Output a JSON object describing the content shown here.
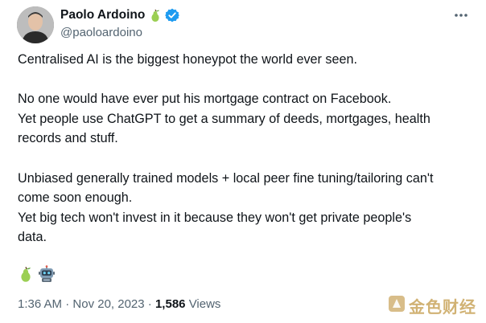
{
  "author": {
    "display_name": "Paolo Ardoino",
    "handle": "@paoloardoino",
    "name_emoji": "pear-icon",
    "verified": true
  },
  "tweet": {
    "paragraphs": [
      [
        "Centralised AI is the biggest honeypot the world ever seen."
      ],
      [
        "No one would have ever put his mortgage contract on Facebook.",
        "Yet people use ChatGPT to get a summary of deeds, mortgages, health",
        "records and stuff."
      ],
      [
        "Unbiased generally trained models + local peer fine tuning/tailoring can't",
        "come soon enough.",
        "Yet big tech won't invest in it because they won't get private people's",
        "data."
      ]
    ],
    "emojis": [
      "pear-icon",
      "robot-icon"
    ]
  },
  "meta": {
    "time": "1:36 AM",
    "separator": "·",
    "date": "Nov 20, 2023",
    "views_count": "1,586",
    "views_label": "Views"
  },
  "watermark": {
    "text": "金色财经"
  },
  "colors": {
    "text": "#0f1419",
    "secondary": "#536471",
    "verified": "#1d9bf0",
    "pear": "#9bcf53",
    "watermark": "#c9a55c"
  }
}
